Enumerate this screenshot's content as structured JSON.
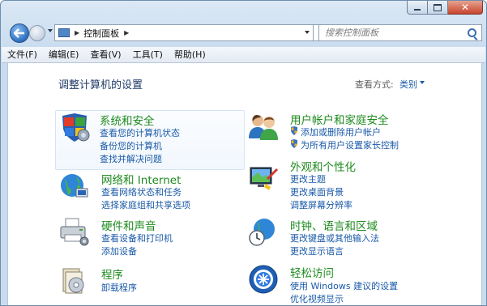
{
  "address": {
    "path": "控制面板"
  },
  "search": {
    "placeholder": "搜索控制面板"
  },
  "menu": [
    "文件(F)",
    "编辑(E)",
    "查看(V)",
    "工具(T)",
    "帮助(H)"
  ],
  "content": {
    "title": "调整计算机的设置",
    "view_by_label": "查看方式:",
    "view_by_value": "类别"
  },
  "categories": {
    "system": {
      "title": "系统和安全",
      "icon": "shield-flag-icon",
      "links": [
        "查看您的计算机状态",
        "备份您的计算机",
        "查找并解决问题"
      ]
    },
    "network": {
      "title": "网络和 Internet",
      "icon": "globe-network-icon",
      "links": [
        "查看网络状态和任务",
        "选择家庭组和共享选项"
      ]
    },
    "hardware": {
      "title": "硬件和声音",
      "icon": "printer-icon",
      "links": [
        "查看设备和打印机",
        "添加设备"
      ]
    },
    "programs": {
      "title": "程序",
      "icon": "programs-icon",
      "links": [
        "卸载程序"
      ]
    },
    "users": {
      "title": "用户帐户和家庭安全",
      "icon": "users-icon",
      "links": [
        "添加或删除用户帐户",
        "为所有用户设置家长控制"
      ]
    },
    "appearance": {
      "title": "外观和个性化",
      "icon": "monitor-paint-icon",
      "links": [
        "更改主题",
        "更改桌面背景",
        "调整屏幕分辨率"
      ]
    },
    "clock": {
      "title": "时钟、语言和区域",
      "icon": "clock-globe-icon",
      "links": [
        "更改键盘或其他输入法",
        "更改显示语言"
      ]
    },
    "ease": {
      "title": "轻松访问",
      "icon": "ease-of-access-icon",
      "links": [
        "使用 Windows 建议的设置",
        "优化视频显示"
      ]
    }
  }
}
